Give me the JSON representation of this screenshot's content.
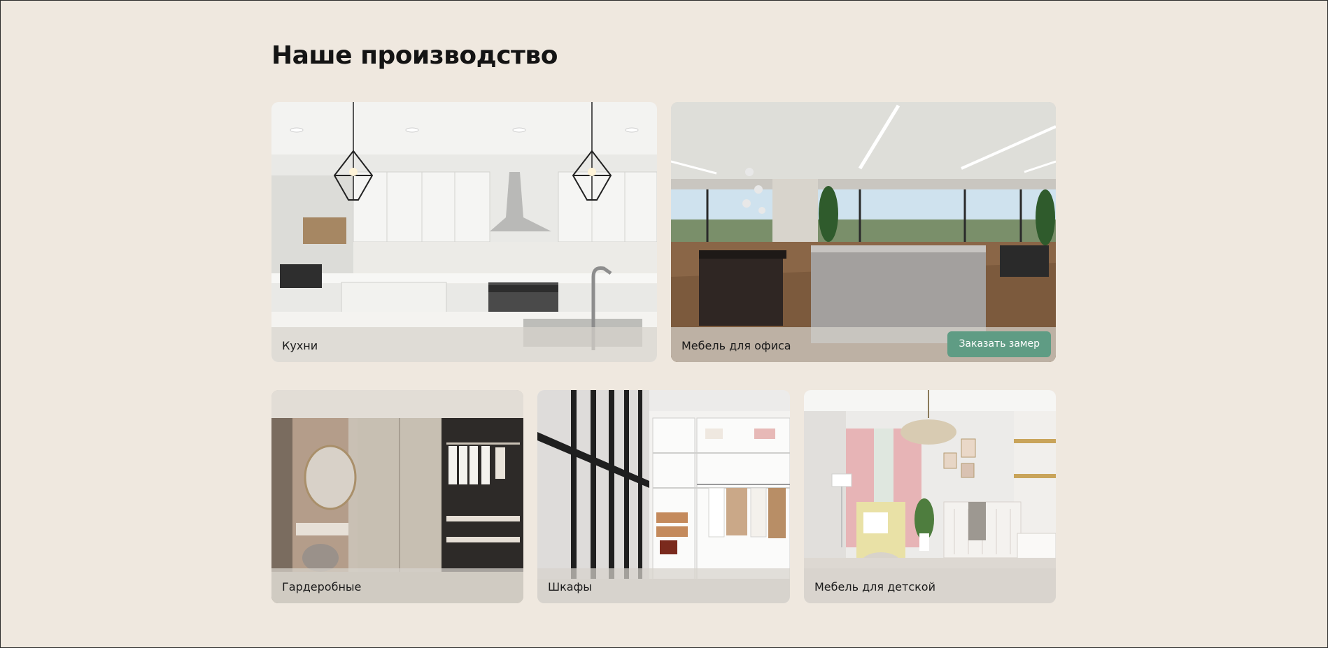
{
  "section": {
    "title": "Наше производство"
  },
  "cards": [
    {
      "label": "Кухни"
    },
    {
      "label": "Мебель для офиса",
      "button": "Заказать замер"
    },
    {
      "label": "Гардеробные"
    },
    {
      "label": "Шкафы"
    },
    {
      "label": "Мебель для детской"
    }
  ],
  "colors": {
    "background": "#efe8df",
    "accent_button": "#5f9c84"
  }
}
